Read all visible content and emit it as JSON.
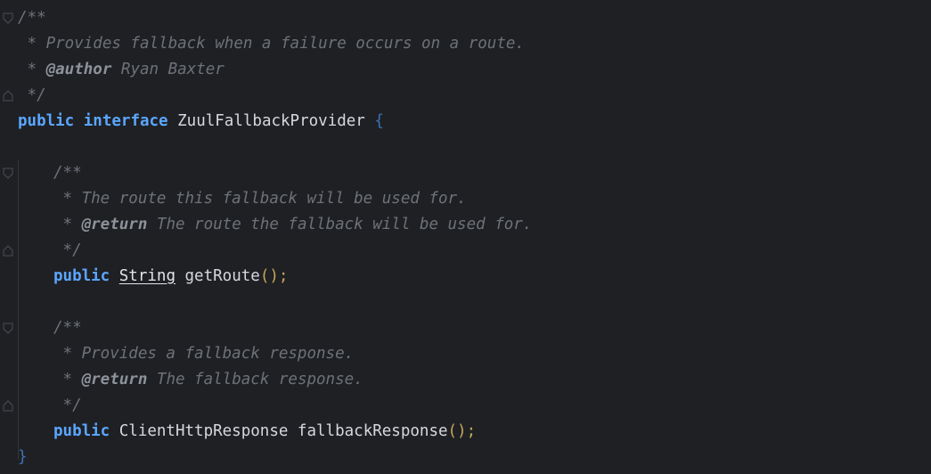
{
  "editor": {
    "lines": [
      {
        "indent": 0,
        "tokens": [
          {
            "t": "cm",
            "v": "/**"
          }
        ]
      },
      {
        "indent": 0,
        "tokens": [
          {
            "t": "cm",
            "v": " * Provides fallback when a failure occurs on a route."
          }
        ]
      },
      {
        "indent": 0,
        "tokens": [
          {
            "t": "cm",
            "v": " * "
          },
          {
            "t": "cm-tag",
            "v": "@author"
          },
          {
            "t": "cm",
            "v": " Ryan Baxter"
          }
        ]
      },
      {
        "indent": 0,
        "tokens": [
          {
            "t": "cm",
            "v": " */"
          }
        ]
      },
      {
        "indent": 0,
        "tokens": [
          {
            "t": "kw",
            "v": "public"
          },
          {
            "t": "id",
            "v": " "
          },
          {
            "t": "kw",
            "v": "interface"
          },
          {
            "t": "id",
            "v": " ZuulFallbackProvider "
          },
          {
            "t": "br",
            "v": "{"
          }
        ]
      },
      {
        "indent": 0,
        "tokens": []
      },
      {
        "indent": 1,
        "tokens": [
          {
            "t": "cm",
            "v": "/**"
          }
        ]
      },
      {
        "indent": 1,
        "tokens": [
          {
            "t": "cm",
            "v": " * The route this fallback will be used for."
          }
        ]
      },
      {
        "indent": 1,
        "tokens": [
          {
            "t": "cm",
            "v": " * "
          },
          {
            "t": "cm-tag",
            "v": "@return"
          },
          {
            "t": "cm",
            "v": " The route the fallback will be used for."
          }
        ]
      },
      {
        "indent": 1,
        "tokens": [
          {
            "t": "cm",
            "v": " */"
          }
        ]
      },
      {
        "indent": 1,
        "tokens": [
          {
            "t": "kw",
            "v": "public"
          },
          {
            "t": "id",
            "v": " "
          },
          {
            "t": "ty-u",
            "v": "String"
          },
          {
            "t": "id",
            "v": " getRoute"
          },
          {
            "t": "pa",
            "v": "()"
          },
          {
            "t": "se",
            "v": ";"
          }
        ]
      },
      {
        "indent": 0,
        "tokens": []
      },
      {
        "indent": 1,
        "tokens": [
          {
            "t": "cm",
            "v": "/**"
          }
        ]
      },
      {
        "indent": 1,
        "tokens": [
          {
            "t": "cm",
            "v": " * Provides a fallback response."
          }
        ]
      },
      {
        "indent": 1,
        "tokens": [
          {
            "t": "cm",
            "v": " * "
          },
          {
            "t": "cm-tag",
            "v": "@return"
          },
          {
            "t": "cm",
            "v": " The fallback response."
          }
        ]
      },
      {
        "indent": 1,
        "tokens": [
          {
            "t": "cm",
            "v": " */"
          }
        ]
      },
      {
        "indent": 1,
        "tokens": [
          {
            "t": "kw",
            "v": "public"
          },
          {
            "t": "id",
            "v": " ClientHttpResponse fallbackResponse"
          },
          {
            "t": "pa",
            "v": "()"
          },
          {
            "t": "se",
            "v": ";"
          }
        ]
      },
      {
        "indent": 0,
        "tokens": [
          {
            "t": "br",
            "v": "}"
          }
        ]
      }
    ]
  },
  "gutter": {
    "fold_icons": [
      {
        "line": 0,
        "kind": "open"
      },
      {
        "line": 3,
        "kind": "close"
      },
      {
        "line": 6,
        "kind": "open"
      },
      {
        "line": 9,
        "kind": "close"
      },
      {
        "line": 12,
        "kind": "open"
      },
      {
        "line": 15,
        "kind": "close"
      }
    ]
  },
  "colors": {
    "background": "#1f2024",
    "keyword": "#5aa6ff",
    "comment": "#6d7278",
    "brace": "#3b73b5",
    "paren": "#c7a85a"
  }
}
